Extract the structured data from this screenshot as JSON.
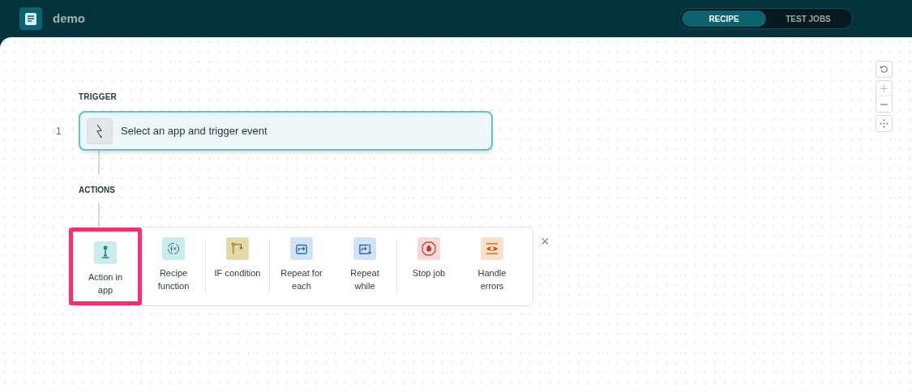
{
  "header": {
    "title": "demo",
    "tabs": [
      {
        "label": "RECIPE",
        "selected": true
      },
      {
        "label": "TEST JOBS",
        "selected": false
      }
    ]
  },
  "trigger": {
    "heading": "TRIGGER",
    "step_number": "1",
    "text": "Select an app and trigger event"
  },
  "actions": {
    "heading": "ACTIONS",
    "groups": [
      [
        {
          "kind": "app",
          "label": "Action in app",
          "color": "#c9ecec",
          "selected": true
        },
        {
          "kind": "function",
          "label": "Recipe function",
          "color": "#c9ecec",
          "selected": false
        }
      ],
      [
        {
          "kind": "if",
          "label": "IF condition",
          "color": "#e3d9a6",
          "selected": false
        }
      ],
      [
        {
          "kind": "foreach",
          "label": "Repeat for each",
          "color": "#cfe2f7",
          "selected": false
        },
        {
          "kind": "while",
          "label": "Repeat while",
          "color": "#cfe2f7",
          "selected": false
        }
      ],
      [
        {
          "kind": "stop",
          "label": "Stop job",
          "color": "#f9d9d6",
          "selected": false
        },
        {
          "kind": "errors",
          "label": "Handle errors",
          "color": "#fbe0c6",
          "selected": false
        }
      ]
    ],
    "close": "×"
  }
}
